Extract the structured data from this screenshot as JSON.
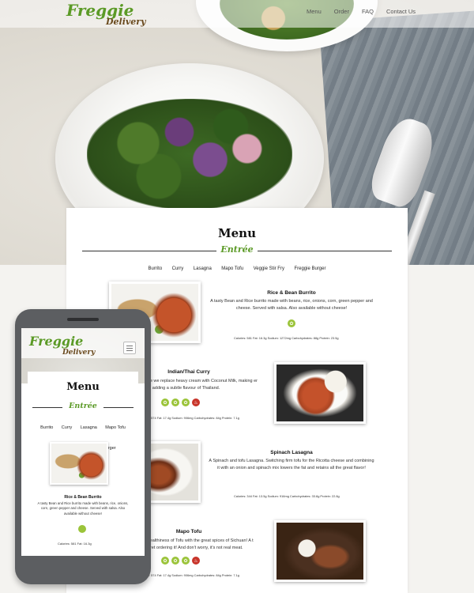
{
  "brand": {
    "name": "Freggie",
    "tagline": "Delivery"
  },
  "nav": {
    "items": [
      "Menu",
      "Order",
      "FAQ",
      "Contact Us"
    ]
  },
  "menu": {
    "title": "Menu",
    "section": "Entrée",
    "categories": [
      "Burrito",
      "Curry",
      "Lasagna",
      "Mapo Tofu",
      "Veggie Stir Fry",
      "Freggie Burger"
    ]
  },
  "dishes": [
    {
      "name": "Rice & Bean Burrito",
      "description": "A tasty Bean and Rice burrito made with beans, rice, onions, corn, green pepper and cheese. Served with salsa. Also available without cheese!",
      "nutrition": "Calories: 581   Fat: 16.3g   Sodium: 1272mg   Carbohydrates: 88g   Protein: 23.5g"
    },
    {
      "name": "Indian/Thai Curry",
      "description": "here we replace heavy cream with Coconut Milk, making er and adding a subtle flavour of Thailand.",
      "nutrition": "ies: 574   Fat: 17.4g   Sodium: 906mg   Carbohydrates: 84g   Protein: 7.1g"
    },
    {
      "name": "Spinach Lasagna",
      "description": "A Spinach and tofu Lasagna. Switching firm tofu for the Ricotta cheese and combining it with an onion and spinach mix lowers the fat and retains all the great flavor!",
      "nutrition": "Calories: 344   Fat: 13.5g   Sodium: 916mg   Carbohydrates: 33.8g   Protein: 22.8g"
    },
    {
      "name": "Mapo Tofu",
      "description": "e healthiness of Tofu with the great spices of Sichuan! A t regret ordering it! And don't worry, it's not real meat.",
      "nutrition": "ies: 574   Fat: 17.4g   Sodium: 906mg   Carbohydrates: 84g   Protein: 7.1g"
    }
  ],
  "mobile": {
    "dish_name": "Rice & Bean Burrito",
    "dish_description": "A tasty Bean and Rice burrito made with beans, rice, onions, corn, green pepper and cheese. Served with salsa. Also available without cheese!",
    "nutrition": "Calories: 581    Fat: 16.3g"
  },
  "icons": {
    "menu_toggle": "hamburger-icon",
    "badge": "leaf-icon"
  },
  "colors": {
    "brand_green": "#5b9a26",
    "brand_brown": "#6a4a1e",
    "badge_green": "#9bc43a",
    "badge_red": "#c8342a"
  }
}
